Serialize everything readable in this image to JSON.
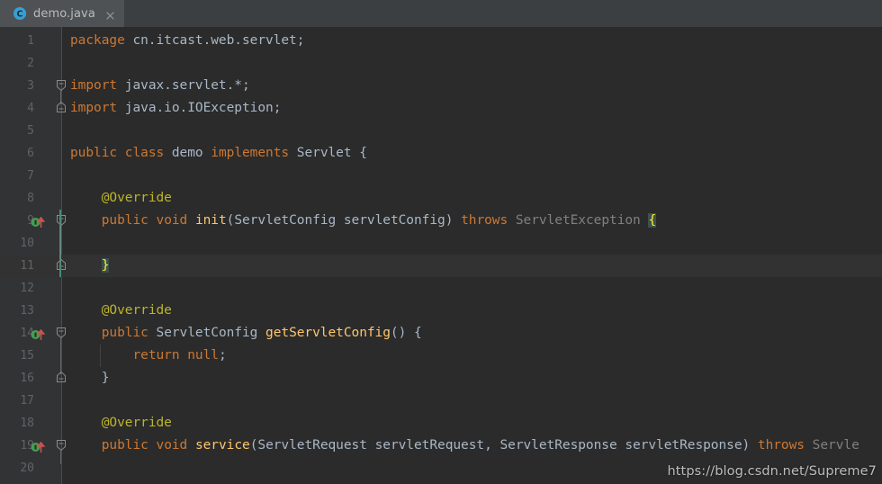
{
  "window": {
    "background": "#2b2b2b",
    "gutter_background": "#313335",
    "tabbar_background": "#3c3f41"
  },
  "tabbar": {
    "tabs": [
      {
        "label": "demo.java",
        "icon": "java-class-icon",
        "close_icon": "close-icon",
        "active": true
      }
    ]
  },
  "editor": {
    "language": "java",
    "current_line": 11,
    "theme_colors": {
      "keyword": "#cc7832",
      "identifier": "#a9b7c6",
      "method": "#ffc66d",
      "annotation": "#bbb529",
      "dimmed": "#808080",
      "brace_match_bg": "#3b514d",
      "brace_match_fg": "#ffef28",
      "line_number": "#606366",
      "caret_row_bg": "#323232",
      "changed_line_marker": "#4a8a78"
    },
    "lines": [
      {
        "number": 1,
        "text": "package cn.itcast.web.servlet;",
        "tokens": [
          {
            "t": "package",
            "c": "kw"
          },
          {
            "t": " cn.itcast.web.servlet;",
            "c": "plain"
          }
        ]
      },
      {
        "number": 2,
        "text": "",
        "tokens": []
      },
      {
        "number": 3,
        "text": "import javax.servlet.*;",
        "fold": "start",
        "tokens": [
          {
            "t": "import",
            "c": "kw"
          },
          {
            "t": " javax.servlet.*;",
            "c": "plain"
          }
        ]
      },
      {
        "number": 4,
        "text": "import java.io.IOException;",
        "fold": "end",
        "tokens": [
          {
            "t": "import",
            "c": "kw"
          },
          {
            "t": " java.io.IOException;",
            "c": "plain"
          }
        ]
      },
      {
        "number": 5,
        "text": "",
        "tokens": []
      },
      {
        "number": 6,
        "text": "public class demo implements Servlet {",
        "tokens": [
          {
            "t": "public",
            "c": "kw"
          },
          {
            "t": " ",
            "c": "plain"
          },
          {
            "t": "class",
            "c": "kw"
          },
          {
            "t": " demo ",
            "c": "plain"
          },
          {
            "t": "implements",
            "c": "kw"
          },
          {
            "t": " Servlet {",
            "c": "plain"
          }
        ]
      },
      {
        "number": 7,
        "text": "",
        "tokens": []
      },
      {
        "number": 8,
        "text": "    @Override",
        "tokens": [
          {
            "t": "    ",
            "c": "plain"
          },
          {
            "t": "@Override",
            "c": "anno"
          }
        ]
      },
      {
        "number": 9,
        "text": "    public void init(ServletConfig servletConfig) throws ServletException {",
        "gutter_icon": "implementing-method-icon",
        "fold": "start",
        "changed": true,
        "tokens": [
          {
            "t": "    ",
            "c": "plain"
          },
          {
            "t": "public",
            "c": "kw"
          },
          {
            "t": " ",
            "c": "plain"
          },
          {
            "t": "void",
            "c": "kw"
          },
          {
            "t": " ",
            "c": "plain"
          },
          {
            "t": "init",
            "c": "mth"
          },
          {
            "t": "(ServletConfig servletConfig) ",
            "c": "plain"
          },
          {
            "t": "throws",
            "c": "kw"
          },
          {
            "t": " ",
            "c": "plain"
          },
          {
            "t": "ServletException",
            "c": "dim"
          },
          {
            "t": " ",
            "c": "plain"
          },
          {
            "t": "{",
            "c": "brace-hl"
          }
        ]
      },
      {
        "number": 10,
        "text": "",
        "changed": true,
        "tokens": []
      },
      {
        "number": 11,
        "text": "    }",
        "fold": "end",
        "current": true,
        "changed": true,
        "tokens": [
          {
            "t": "    ",
            "c": "plain"
          },
          {
            "t": "}",
            "c": "brace-hl"
          }
        ]
      },
      {
        "number": 12,
        "text": "",
        "tokens": []
      },
      {
        "number": 13,
        "text": "    @Override",
        "tokens": [
          {
            "t": "    ",
            "c": "plain"
          },
          {
            "t": "@Override",
            "c": "anno"
          }
        ]
      },
      {
        "number": 14,
        "text": "    public ServletConfig getServletConfig() {",
        "gutter_icon": "implementing-method-icon",
        "fold": "start",
        "tokens": [
          {
            "t": "    ",
            "c": "plain"
          },
          {
            "t": "public",
            "c": "kw"
          },
          {
            "t": " ServletConfig ",
            "c": "plain"
          },
          {
            "t": "getServletConfig",
            "c": "mth"
          },
          {
            "t": "() {",
            "c": "plain"
          }
        ]
      },
      {
        "number": 15,
        "text": "        return null;",
        "indent_guide": true,
        "tokens": [
          {
            "t": "        ",
            "c": "plain"
          },
          {
            "t": "return",
            "c": "kw"
          },
          {
            "t": " ",
            "c": "plain"
          },
          {
            "t": "null",
            "c": "kw"
          },
          {
            "t": ";",
            "c": "plain"
          }
        ]
      },
      {
        "number": 16,
        "text": "    }",
        "fold": "end",
        "tokens": [
          {
            "t": "    ",
            "c": "plain"
          },
          {
            "t": "}",
            "c": "plain"
          }
        ]
      },
      {
        "number": 17,
        "text": "",
        "tokens": []
      },
      {
        "number": 18,
        "text": "    @Override",
        "tokens": [
          {
            "t": "    ",
            "c": "plain"
          },
          {
            "t": "@Override",
            "c": "anno"
          }
        ]
      },
      {
        "number": 19,
        "text": "    public void service(ServletRequest servletRequest, ServletResponse servletResponse) throws Servle",
        "gutter_icon": "implementing-method-icon",
        "fold": "start",
        "truncated": true,
        "tokens": [
          {
            "t": "    ",
            "c": "plain"
          },
          {
            "t": "public",
            "c": "kw"
          },
          {
            "t": " ",
            "c": "plain"
          },
          {
            "t": "void",
            "c": "kw"
          },
          {
            "t": " ",
            "c": "plain"
          },
          {
            "t": "service",
            "c": "mth"
          },
          {
            "t": "(ServletRequest servletRequest, ServletResponse servletResponse) ",
            "c": "plain"
          },
          {
            "t": "throws",
            "c": "kw"
          },
          {
            "t": " ",
            "c": "plain"
          },
          {
            "t": "Servle",
            "c": "dim"
          }
        ]
      },
      {
        "number": 20,
        "text": "",
        "tokens": []
      }
    ]
  },
  "watermark": {
    "text": "https://blog.csdn.net/Supreme7"
  }
}
